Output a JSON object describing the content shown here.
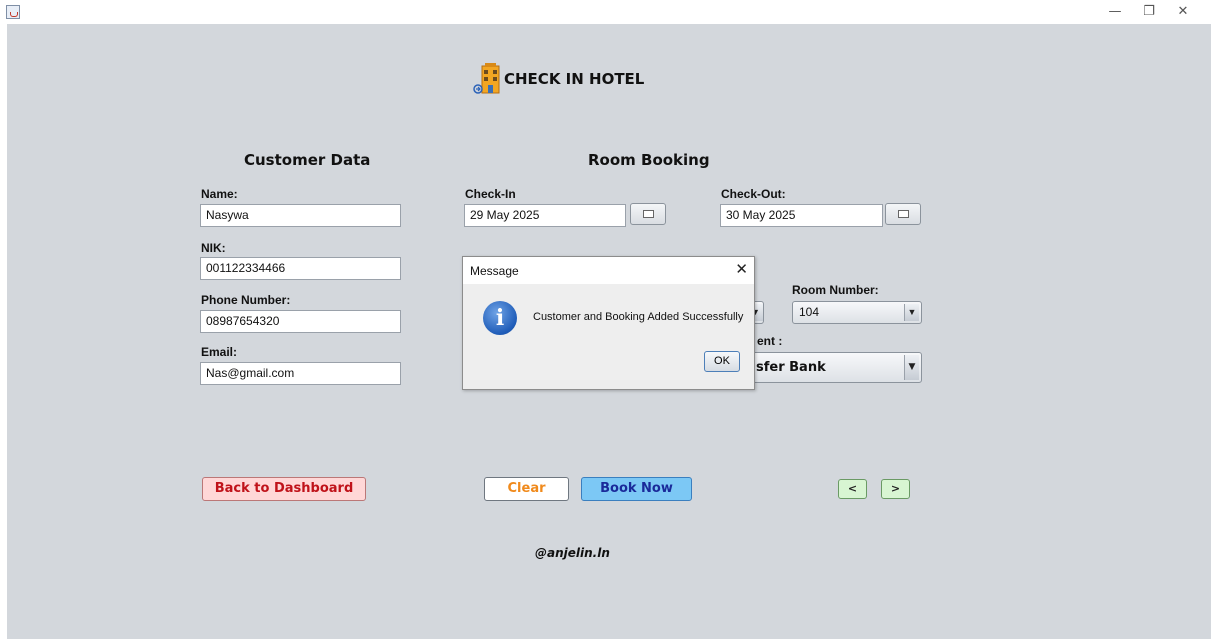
{
  "window": {
    "minimize": "—",
    "restore": "❐",
    "close": "✕"
  },
  "header": {
    "title": "CHECK IN HOTEL",
    "icon": "hotel-building-icon"
  },
  "customer": {
    "section_title": "Customer Data",
    "name_label": "Name:",
    "name_value": "Nasywa",
    "nik_label": "NIK:",
    "nik_value": "001122334466",
    "phone_label": "Phone Number:",
    "phone_value": "08987654320",
    "email_label": "Email:",
    "email_value": "Nas@gmail.com"
  },
  "booking": {
    "section_title": "Room Booking",
    "checkin_label": "Check-In",
    "checkin_value": "29 May 2025",
    "checkout_label": "Check-Out:",
    "checkout_value": "30 May 2025",
    "room_number_label": "Room Number:",
    "room_number_value": "104",
    "payment_label_partial": "ent :",
    "payment_value_partial": "sfer Bank"
  },
  "buttons": {
    "back": "Back to Dashboard",
    "clear": "Clear",
    "book": "Book Now",
    "prev": "<",
    "next": ">"
  },
  "footer": {
    "credit": "@anjelin.ln"
  },
  "dialog": {
    "title": "Message",
    "close": "✕",
    "icon": "info-icon",
    "message": "Customer and Booking Added Successfully",
    "ok": "OK"
  },
  "colors": {
    "background": "#d3d7dc",
    "back_button": "#ffd7d7",
    "back_text": "#c0121a",
    "clear_text": "#f08a1c",
    "book_button": "#7cc8f5",
    "book_text": "#1a2a9a",
    "nav_button": "#d8f5d2"
  }
}
